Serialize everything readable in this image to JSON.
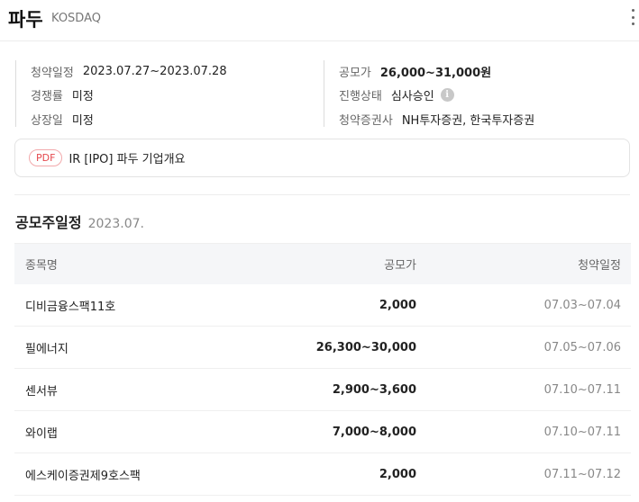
{
  "header": {
    "title": "파두",
    "market": "KOSDAQ"
  },
  "info": {
    "left": [
      {
        "key": "청약일정",
        "value": "2023.07.27~2023.07.28"
      },
      {
        "key": "경쟁률",
        "value": "미정"
      },
      {
        "key": "상장일",
        "value": "미정"
      }
    ],
    "right": [
      {
        "key": "공모가",
        "value": "26,000~31,000원"
      },
      {
        "key": "진행상태",
        "value": "심사승인"
      },
      {
        "key": "청약증권사",
        "value": "NH투자증권, 한국투자증권"
      }
    ],
    "info_icon": "info-icon"
  },
  "pdf": {
    "badge": "PDF",
    "label": "IR [IPO] 파두 기업개요"
  },
  "schedule": {
    "title": "공모주일정",
    "month": "2023.07.",
    "columns": [
      "종목명",
      "공모가",
      "청약일정"
    ],
    "rows": [
      {
        "name": "디비금융스팩11호",
        "price": "2,000",
        "period": "07.03~07.04"
      },
      {
        "name": "필에너지",
        "price": "26,300~30,000",
        "period": "07.05~07.06"
      },
      {
        "name": "센서뷰",
        "price": "2,900~3,600",
        "period": "07.10~07.11"
      },
      {
        "name": "와이랩",
        "price": "7,000~8,000",
        "period": "07.10~07.11"
      },
      {
        "name": "에스케이증권제9호스팩",
        "price": "2,000",
        "period": "07.11~07.12"
      }
    ]
  },
  "colors": {
    "pdf_accent": "#e5484d",
    "header_bg": "#f5f6f8"
  }
}
